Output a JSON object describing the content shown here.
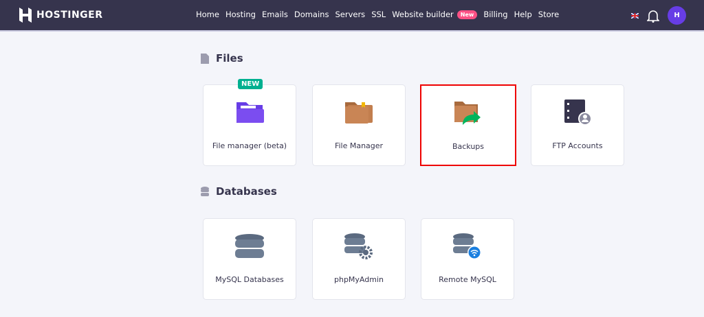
{
  "nav": {
    "brand": "HOSTINGER",
    "items": [
      "Home",
      "Hosting",
      "Emails",
      "Domains",
      "Servers",
      "SSL",
      "Website builder",
      "Billing",
      "Help",
      "Store"
    ],
    "new_badge": "New",
    "avatar": "H"
  },
  "files": {
    "title": "Files",
    "cards": [
      {
        "label": "File manager (beta)",
        "badge": "NEW"
      },
      {
        "label": "File Manager"
      },
      {
        "label": "Backups"
      },
      {
        "label": "FTP Accounts"
      }
    ]
  },
  "databases": {
    "title": "Databases",
    "cards": [
      {
        "label": "MySQL Databases"
      },
      {
        "label": "phpMyAdmin"
      },
      {
        "label": "Remote MySQL"
      }
    ]
  }
}
